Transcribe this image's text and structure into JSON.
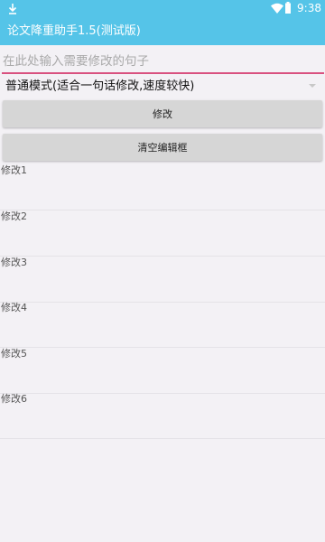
{
  "status_bar": {
    "time": "9:38",
    "icons": [
      "download-icon",
      "wifi-icon",
      "battery-icon"
    ]
  },
  "app_bar": {
    "title": "论文降重助手1.5(测试版)"
  },
  "input": {
    "placeholder": "在此处输入需要修改的句子",
    "value": ""
  },
  "mode_select": {
    "selected": "普通模式(适合一句话修改,速度较快)"
  },
  "buttons": {
    "modify_label": "修改",
    "clear_label": "清空编辑框"
  },
  "results": [
    {
      "label": "修改1",
      "text": ""
    },
    {
      "label": "修改2",
      "text": ""
    },
    {
      "label": "修改3",
      "text": ""
    },
    {
      "label": "修改4",
      "text": ""
    },
    {
      "label": "修改5",
      "text": ""
    },
    {
      "label": "修改6",
      "text": ""
    }
  ],
  "colors": {
    "app_bar": "#55c4e8",
    "input_underline": "#d9517f",
    "background": "#f3f1f5",
    "button": "#d6d6d6"
  }
}
